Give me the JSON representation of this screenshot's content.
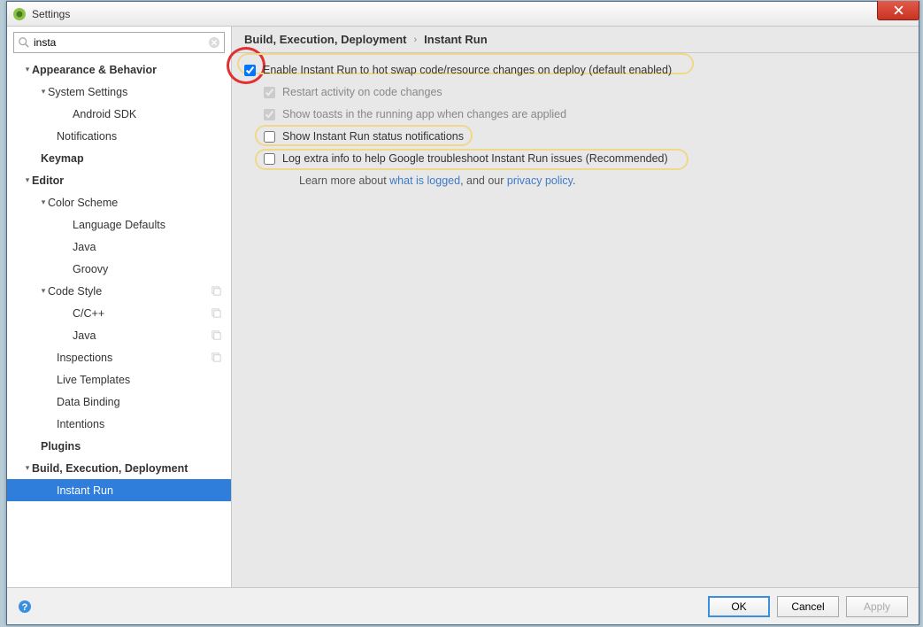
{
  "window": {
    "title": "Settings"
  },
  "search": {
    "value": "insta"
  },
  "tree": {
    "appearance": "Appearance & Behavior",
    "system_settings": "System Settings",
    "android_sdk": "Android SDK",
    "notifications": "Notifications",
    "keymap": "Keymap",
    "editor": "Editor",
    "color_scheme": "Color Scheme",
    "lang_defaults": "Language Defaults",
    "java_color": "Java",
    "groovy": "Groovy",
    "code_style": "Code Style",
    "cpp": "C/C++",
    "java_style": "Java",
    "inspections": "Inspections",
    "live_templates": "Live Templates",
    "data_binding": "Data Binding",
    "intentions": "Intentions",
    "plugins": "Plugins",
    "bed": "Build, Execution, Deployment",
    "instant_run": "Instant Run"
  },
  "breadcrumb": {
    "root": "Build, Execution, Deployment",
    "leaf": "Instant Run"
  },
  "options": {
    "enable": "Enable Instant Run to hot swap code/resource changes on deploy (default enabled)",
    "restart": "Restart activity on code changes",
    "toasts": "Show toasts in the running app when changes are applied",
    "status": "Show Instant Run status notifications",
    "logextra": "Log extra info to help Google troubleshoot Instant Run issues (Recommended)"
  },
  "learn": {
    "prefix": "Learn more about ",
    "link1": "what is logged",
    "mid": ", and our ",
    "link2": "privacy policy",
    "suffix": "."
  },
  "buttons": {
    "ok": "OK",
    "cancel": "Cancel",
    "apply": "Apply"
  }
}
